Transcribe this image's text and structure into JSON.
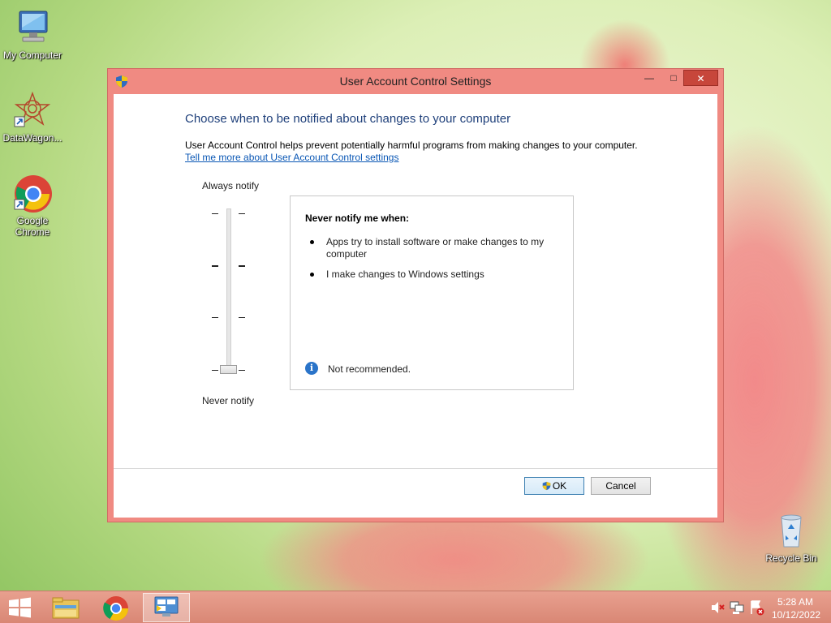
{
  "desktop": {
    "icons": [
      {
        "label": "My Computer",
        "icon": "computer-icon"
      },
      {
        "label": "DataWagon...",
        "icon": "datawagon-icon"
      },
      {
        "label": "Google Chrome",
        "icon": "chrome-icon"
      },
      {
        "label": "Recycle Bin",
        "icon": "recycle-bin-icon"
      }
    ]
  },
  "window": {
    "title": "User Account Control Settings",
    "controls": {
      "minimize": "—",
      "maximize": "□",
      "close": "✕"
    },
    "heading": "Choose when to be notified about changes to your computer",
    "description": "User Account Control helps prevent potentially harmful programs from making changes to your computer.",
    "learn_more": "Tell me more about User Account Control settings",
    "slider": {
      "top_label": "Always notify",
      "bottom_label": "Never notify",
      "levels": 4,
      "selected_level": 1
    },
    "info": {
      "title": "Never notify me when:",
      "items": [
        "Apps try to install software or make changes to my computer",
        "I make changes to Windows settings"
      ],
      "note": "Not recommended."
    },
    "buttons": {
      "ok": "OK",
      "cancel": "Cancel"
    }
  },
  "taskbar": {
    "items": [
      "start-icon",
      "file-explorer-icon",
      "chrome-icon",
      "uac-settings-icon"
    ],
    "tray": [
      "volume-muted-icon",
      "network-icon",
      "action-center-icon"
    ],
    "time": "5:28 AM",
    "date": "10/12/2022"
  },
  "colors": {
    "window_frame": "#f08a82",
    "close_button": "#c7463b",
    "heading": "#1e3f7a",
    "link": "#0a57b5",
    "taskbar": "#d98775"
  }
}
